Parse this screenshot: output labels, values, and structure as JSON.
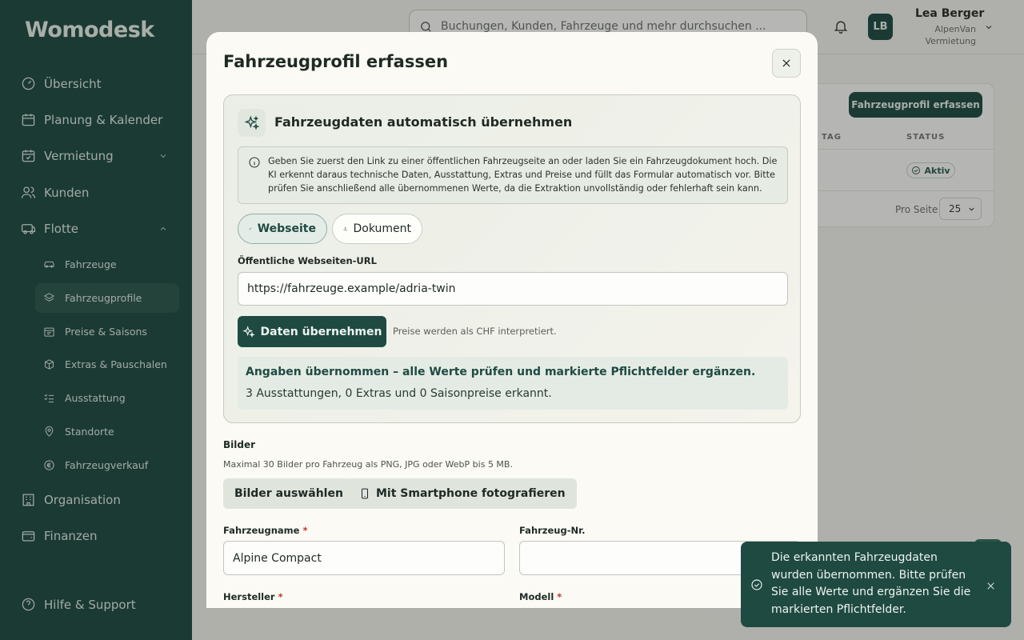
{
  "app": {
    "logo": "Womodesk"
  },
  "sidebar": {
    "items": [
      {
        "label": "Übersicht",
        "icon": "gauge-icon"
      },
      {
        "label": "Planung & Kalender",
        "icon": "calendar-icon"
      },
      {
        "label": "Vermietung",
        "icon": "calendar-check-icon"
      },
      {
        "label": "Kunden",
        "icon": "users-icon"
      },
      {
        "label": "Flotte",
        "icon": "van-icon"
      },
      {
        "label": "Organisation",
        "icon": "building-icon"
      },
      {
        "label": "Finanzen",
        "icon": "wallet-icon"
      }
    ],
    "sub_items": [
      {
        "label": "Fahrzeuge",
        "icon": "car-icon"
      },
      {
        "label": "Fahrzeugprofile",
        "icon": "layers-icon"
      },
      {
        "label": "Preise & Saisons",
        "icon": "calendar-icon"
      },
      {
        "label": "Extras & Pauschalen",
        "icon": "package-icon"
      },
      {
        "label": "Ausstattung",
        "icon": "list-check-icon"
      },
      {
        "label": "Standorte",
        "icon": "map-pin-icon"
      },
      {
        "label": "Fahrzeugverkauf",
        "icon": "coin-icon"
      }
    ],
    "help": "Hilfe & Support"
  },
  "topbar": {
    "search_placeholder": "Buchungen, Kunden, Fahrzeuge und mehr durchsuchen ...",
    "avatar_initials": "LB",
    "user_name": "Lea Berger",
    "user_org_line1": "AlpenVan",
    "user_org_line2": "Vermietung"
  },
  "background": {
    "create_button": "Fahrzeugprofil erfassen",
    "col_tag": "TAG",
    "col_status": "STATUS",
    "status_badge": "Aktiv",
    "per_page_label": "Pro Seite",
    "per_page_value": "25"
  },
  "modal": {
    "title": "Fahrzeugprofil erfassen",
    "ai": {
      "title": "Fahrzeugdaten automatisch übernehmen",
      "info_text": "Geben Sie zuerst den Link zu einer öffentlichen Fahrzeugseite an oder laden Sie ein Fahrzeugdokument hoch. Die KI erkennt daraus technische Daten, Ausstattung, Extras und Preise und füllt das Formular automatisch vor. Bitte prüfen Sie anschließend alle übernommenen Werte, da die Extraktion unvollständig oder fehlerhaft sein kann.",
      "tab_website": "Webseite",
      "tab_document": "Dokument",
      "url_label": "Öffentliche Webseiten-URL",
      "url_value": "https://fahrzeuge.example/adria-twin",
      "apply_button": "Daten übernehmen",
      "currency_hint": "Preise werden als CHF interpretiert.",
      "result_title": "Angaben übernommen – alle Werte prüfen und markierte Pflichtfelder ergänzen.",
      "result_detail": "3 Ausstattungen, 0 Extras und 0 Saisonpreise erkannt."
    },
    "images": {
      "title": "Bilder",
      "hint": "Maximal 30 Bilder pro Fahrzeug als PNG, JPG oder WebP bis 5 MB.",
      "select_button": "Bilder auswählen",
      "phone_button": "Mit Smartphone fotografieren"
    },
    "fields": {
      "name_label": "Fahrzeugname",
      "name_value": "Alpine Compact",
      "number_label": "Fahrzeug-Nr.",
      "number_value": "",
      "maker_label": "Hersteller",
      "model_label": "Modell",
      "required_mark": "*"
    }
  },
  "toast": {
    "message": "Die erkannten Fahrzeugdaten wurden übernommen. Bitte prüfen Sie alle Werte und ergänzen Sie die markierten Pflichtfelder."
  },
  "colors": {
    "brand": "#1f4a42",
    "required": "#c0392b"
  }
}
